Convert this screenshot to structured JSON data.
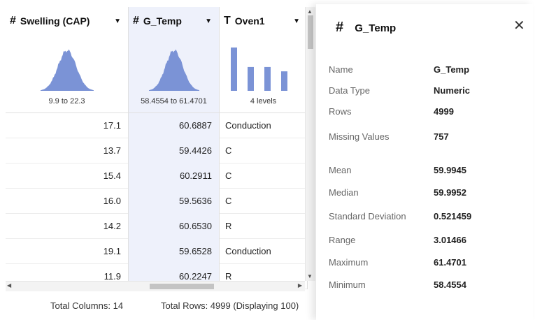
{
  "grid": {
    "columns": [
      {
        "type_glyph": "#",
        "name": "Swelling (CAP)",
        "range": "9.9 to 22.3"
      },
      {
        "type_glyph": "#",
        "name": "G_Temp",
        "range": "58.4554 to 61.4701"
      },
      {
        "type_glyph": "T",
        "name": "Oven1",
        "range": "4 levels"
      }
    ],
    "rows": [
      [
        "17.1",
        "60.6887",
        "Conduction"
      ],
      [
        "13.7",
        "59.4426",
        "C"
      ],
      [
        "15.4",
        "60.2911",
        "C"
      ],
      [
        "16.0",
        "59.5636",
        "C"
      ],
      [
        "14.2",
        "60.6530",
        "R"
      ],
      [
        "19.1",
        "59.6528",
        "Conduction"
      ],
      [
        "11.9",
        "60.2247",
        "R"
      ]
    ],
    "level_bar_heights": [
      1.0,
      0.55,
      0.55,
      0.45
    ],
    "accent": "#7b93d6",
    "selected_bg": "#eef1fb"
  },
  "footer": {
    "total_columns": "Total Columns: 14",
    "total_rows": "Total Rows: 4999 (Displaying 100)"
  },
  "summary": {
    "title": "G_Temp",
    "title_glyph": "#",
    "close_glyph": "✕",
    "stats": [
      {
        "label": "Name",
        "value": "G_Temp"
      },
      {
        "label": "Data Type",
        "value": "Numeric"
      },
      {
        "label": "Rows",
        "value": "4999"
      },
      {
        "label": "Missing Values",
        "value": "757"
      },
      {
        "label": "Mean",
        "value": "59.9945"
      },
      {
        "label": "Median",
        "value": "59.9952"
      },
      {
        "label": "Standard Deviation",
        "value": "0.521459"
      },
      {
        "label": "Range",
        "value": "3.01466"
      },
      {
        "label": "Maximum",
        "value": "61.4701"
      },
      {
        "label": "Minimum",
        "value": "58.4554"
      }
    ]
  }
}
